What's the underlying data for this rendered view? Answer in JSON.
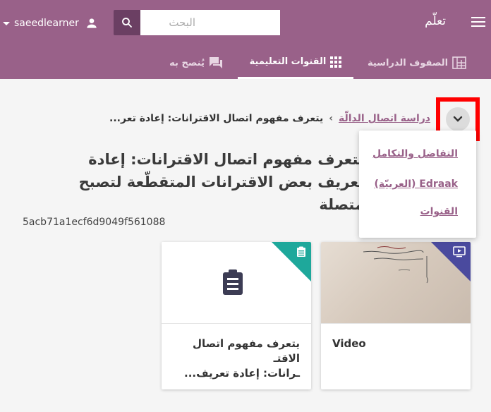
{
  "header": {
    "username": "saeedlearner",
    "search_placeholder": "البحث",
    "brand": "تعلّم",
    "tabs": [
      {
        "label": "الصفوف الدراسية",
        "icon": "classes-icon"
      },
      {
        "label": "القنوات التعليمية",
        "icon": "channels-grid-icon",
        "active": true
      },
      {
        "label": "يُنصح به",
        "icon": "recommended-icon"
      }
    ]
  },
  "breadcrumb": {
    "link": "دراسة اتصال الدالّة",
    "separator": "›",
    "current": "يتعرف مفهوم اتصال الاقترانات: إعادة تعر..."
  },
  "dropdown": {
    "items": [
      "التفاضل والتكامل",
      "Edraak (العربيّة)",
      "القنوات"
    ]
  },
  "page": {
    "title": "يتعرف مفهوم اتصال الاقترانات: إعادة تعريف بعض الاقترانات المتقطّعة لتصبح متصلة",
    "content_id": "5acb71a1ecf6d9049f561088"
  },
  "cards": [
    {
      "title": "Video",
      "kind": "video",
      "corner_color": "#4a4a9e"
    },
    {
      "title_line1": "يتعرف مفهوم اتصال الاقتـ",
      "title_line2": "ـرانات: إعادة تعريف...",
      "kind": "exercise",
      "corner_color": "#1ea89b"
    }
  ],
  "colors": {
    "brand": "#996189",
    "brand_dark": "#6b3f63",
    "highlight": "#ff0000"
  }
}
